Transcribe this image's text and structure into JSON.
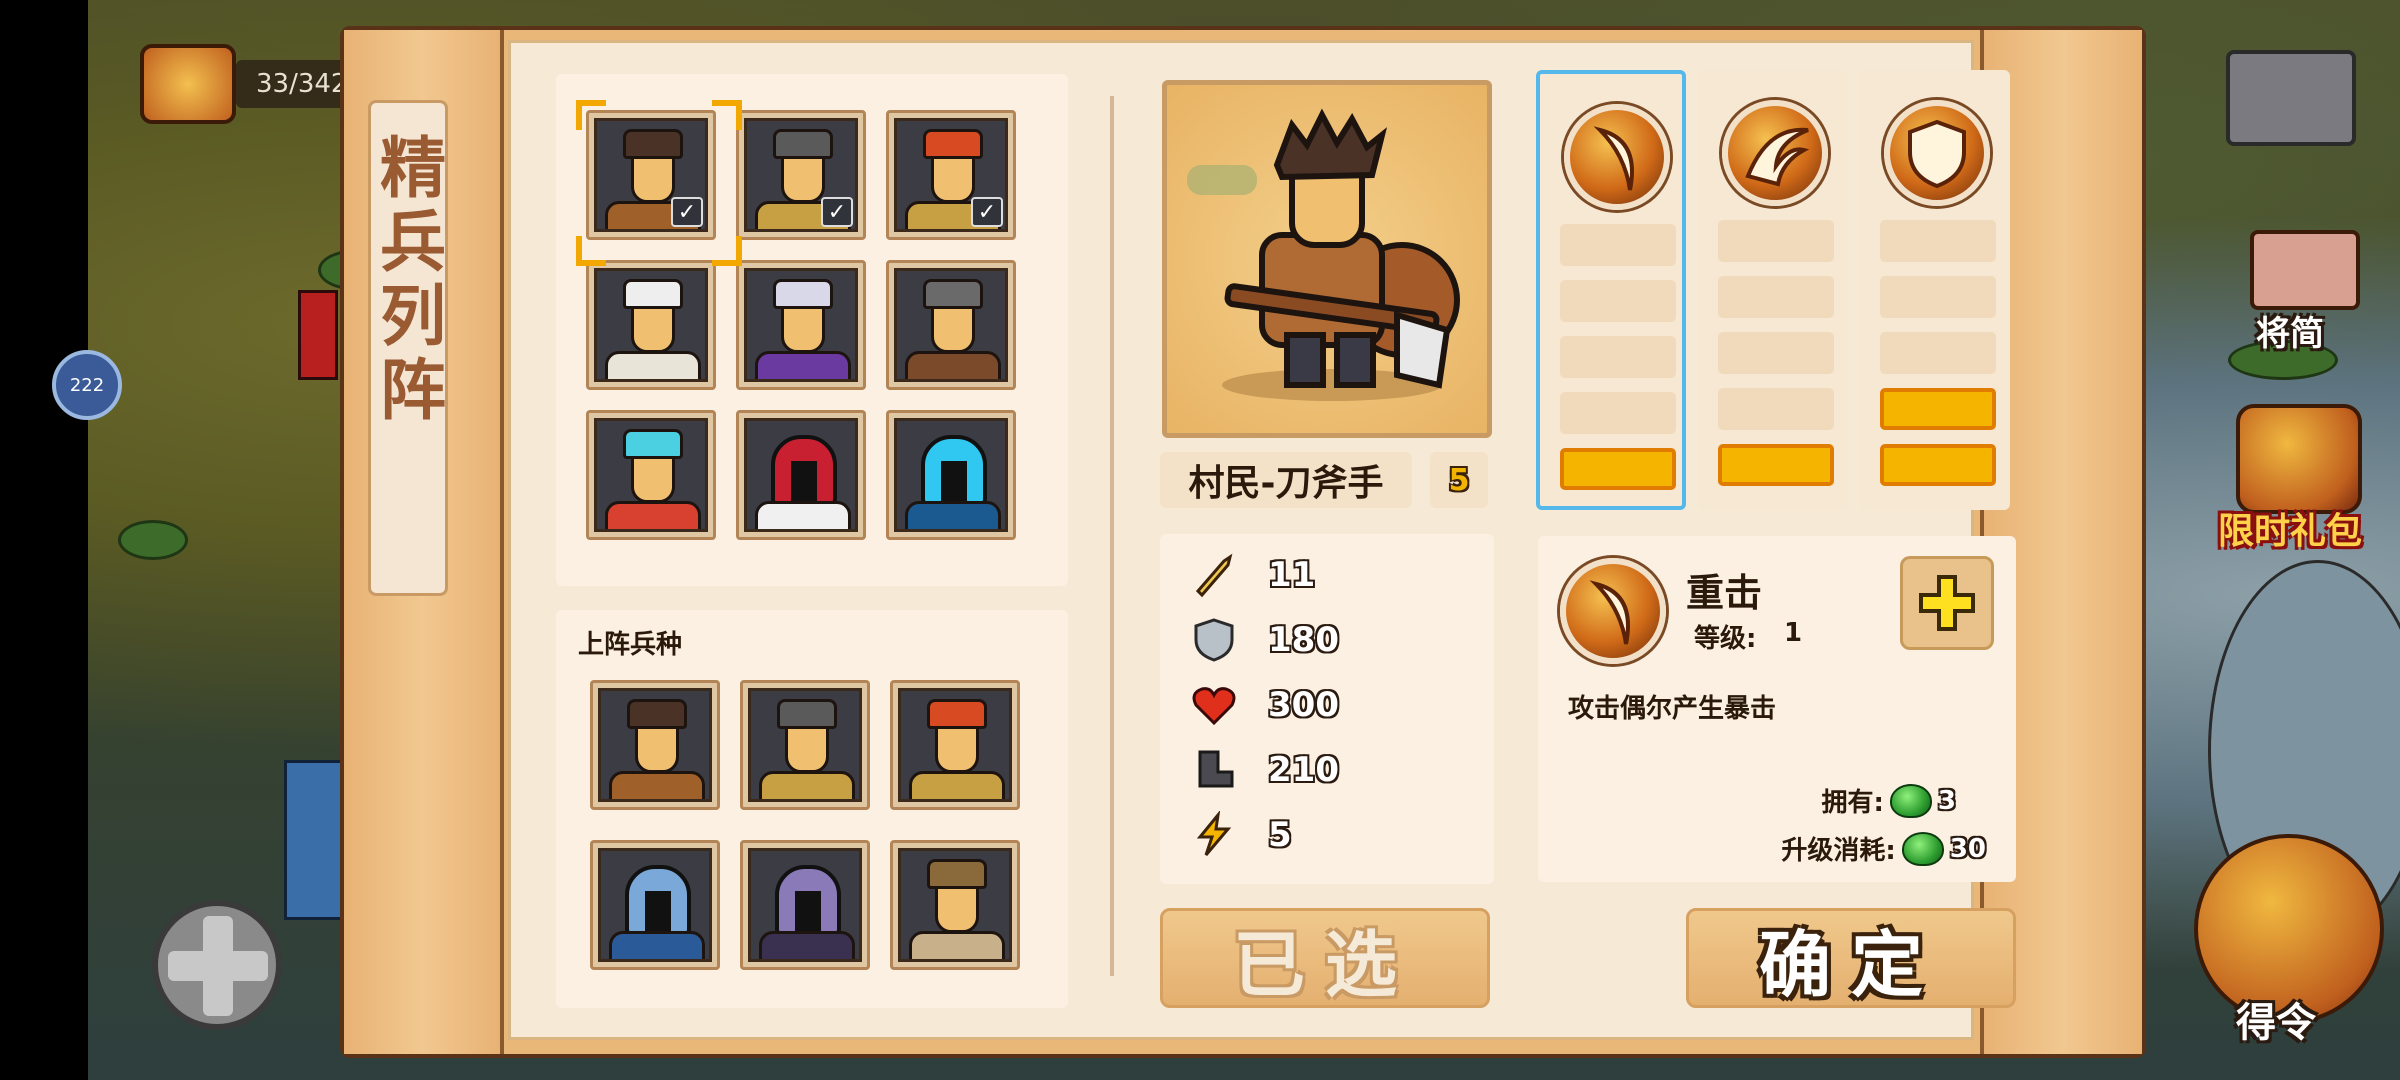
{
  "hud": {
    "counter": "33/342",
    "left_badge": "222"
  },
  "panel": {
    "title": "精兵列阵"
  },
  "side_menu": [
    {
      "label": "将简",
      "icon": "book-icon"
    },
    {
      "label": "限时礼包",
      "icon": "gift-bag-icon"
    },
    {
      "label": "得令",
      "icon": "command-token-icon"
    }
  ],
  "roster": {
    "units": [
      {
        "name": "villager-axeman",
        "hair": "#4a3226",
        "armor": "#a0602a",
        "checked": true,
        "selected": true
      },
      {
        "name": "villager-spearman",
        "hair": "#5a5a5a",
        "armor": "#c8a044",
        "checked": true
      },
      {
        "name": "villager-warrior",
        "hair": "#d84a22",
        "armor": "#c8a044",
        "checked": true
      },
      {
        "name": "monk",
        "hair": "#eeeeee",
        "armor": "#e8e4d8"
      },
      {
        "name": "mage",
        "hair": "#d8d8e8",
        "armor": "#6a3aa0"
      },
      {
        "name": "chariot",
        "hair": "#6a6a6a",
        "armor": "#7a4a2a"
      },
      {
        "name": "water-dragon",
        "hair": "#4ad0e0",
        "armor": "#d84030"
      },
      {
        "name": "red-knight",
        "hair": "#c82030",
        "armor": "#f0f0f0"
      },
      {
        "name": "blue-knight",
        "hair": "#30c8f0",
        "armor": "#1a5a90"
      }
    ]
  },
  "deployed": {
    "label": "上阵兵种",
    "units": [
      {
        "name": "villager-axeman",
        "hair": "#4a3226",
        "armor": "#a0602a"
      },
      {
        "name": "villager-spearman",
        "hair": "#5a5a5a",
        "armor": "#c8a044"
      },
      {
        "name": "villager-warrior",
        "hair": "#d84a22",
        "armor": "#c8a044"
      },
      {
        "name": "blue-armored-knight",
        "hair": "#7aa8d8",
        "armor": "#2a5a98"
      },
      {
        "name": "dark-knight",
        "hair": "#8a7ab8",
        "armor": "#3a3050"
      },
      {
        "name": "griffin",
        "hair": "#8a6a3a",
        "armor": "#c8b08a"
      }
    ]
  },
  "unit_detail": {
    "name": "村民-刀斧手",
    "level": "5",
    "stats": [
      {
        "icon": "sword-icon",
        "value": "11"
      },
      {
        "icon": "shield-icon",
        "value": "180"
      },
      {
        "icon": "heart-icon",
        "value": "300"
      },
      {
        "icon": "boot-icon",
        "value": "210"
      },
      {
        "icon": "lightning-icon",
        "value": "5"
      }
    ]
  },
  "skills": [
    {
      "icon": "slash-icon",
      "filled_slots": 1,
      "selected": true
    },
    {
      "icon": "flame-claw-icon",
      "filled_slots": 1
    },
    {
      "icon": "shield-crest-icon",
      "filled_slots": 2
    }
  ],
  "skill_info": {
    "name": "重击",
    "level_label": "等级:",
    "level_value": "1",
    "description": "攻击偶尔产生暴击",
    "own_label": "拥有:",
    "own_value": "3",
    "cost_label": "升级消耗:",
    "cost_value": "30"
  },
  "buttons": {
    "selected": "已选",
    "confirm": "确定"
  },
  "colors": {
    "frame": "#e9b878",
    "panel": "#f6e9d6",
    "accent_gold": "#f5b400",
    "select_blue": "#55b8ea"
  }
}
